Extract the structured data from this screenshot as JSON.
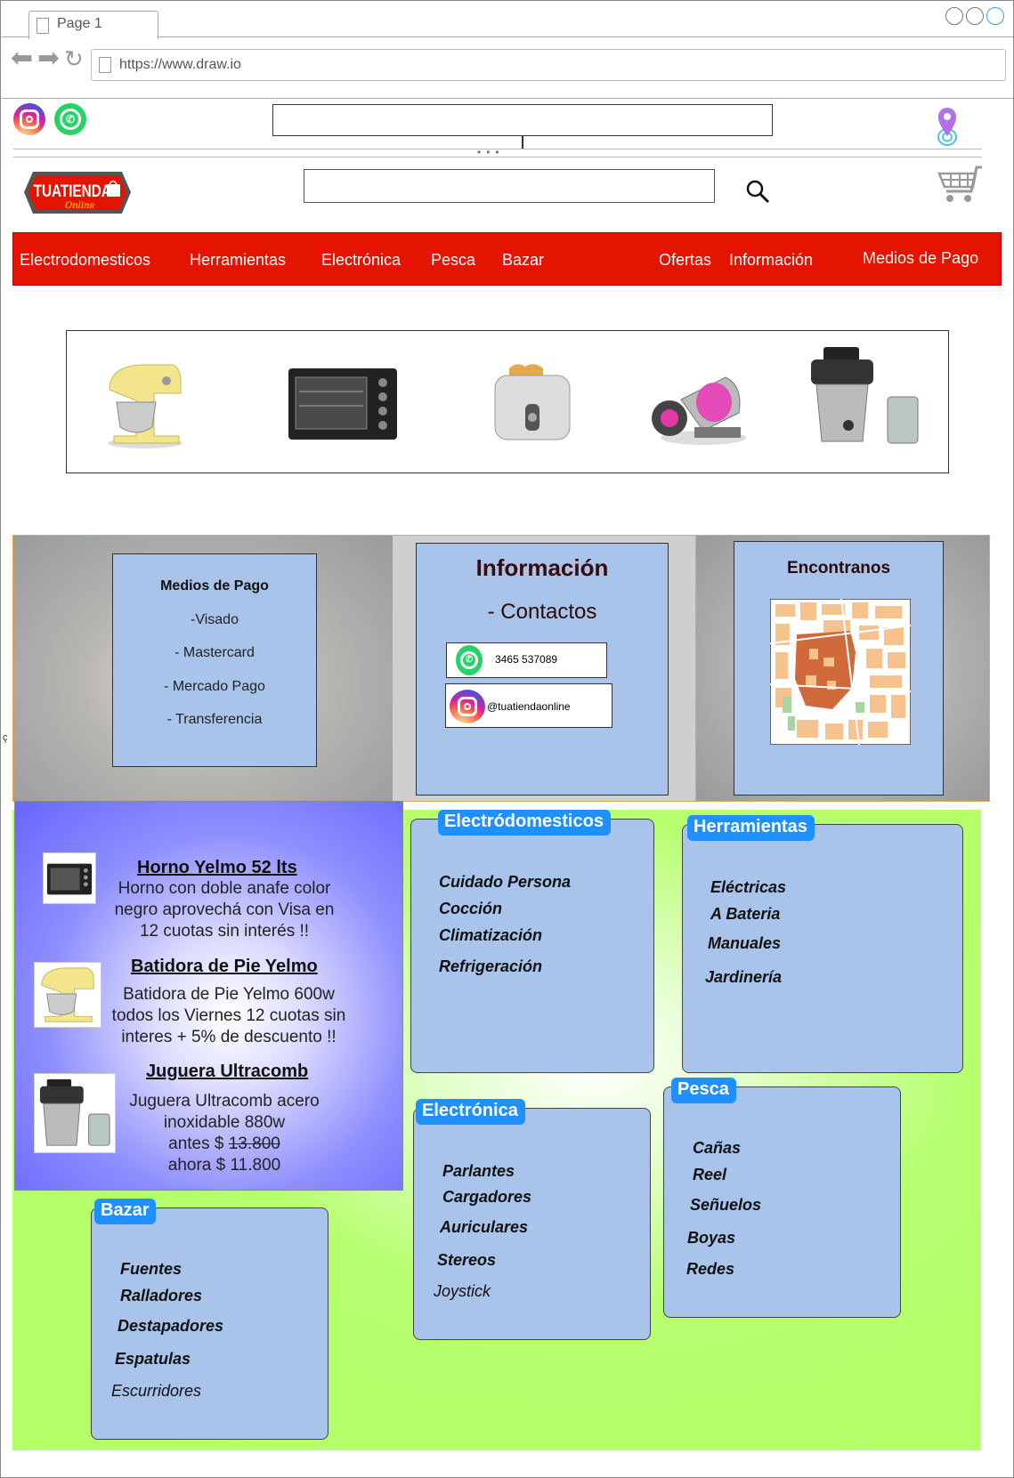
{
  "browser": {
    "tab_title": "Page 1",
    "url": "https://www.draw.io"
  },
  "header": {
    "logo_text": "TUATIENDA",
    "logo_sub": "Online",
    "icons": [
      "instagram-icon",
      "whatsapp-icon",
      "location-pin-icon",
      "search-icon",
      "cart-icon"
    ]
  },
  "menu": {
    "items": [
      "Electrodomesticos",
      "Herramientas",
      "Electrónica",
      "Pesca",
      "Bazar",
      "Ofertas",
      "Información",
      "Medios de Pago"
    ]
  },
  "banner": {
    "products": [
      "stand-mixer",
      "toaster-oven",
      "toaster",
      "vacuum-cleaner",
      "juicer"
    ]
  },
  "payment": {
    "title": "Medios de Pago",
    "items": [
      "-Visado",
      "- Mastercard",
      "- Mercado Pago",
      "- Transferencia"
    ]
  },
  "info": {
    "title": "Información",
    "subtitle": "- Contactos",
    "phone": "3465 537089",
    "instagram": "@tuatiendaonline"
  },
  "find_us": {
    "title": "Encontranos"
  },
  "stray_char": "ç",
  "promos": [
    {
      "title": "Horno Yelmo 52 lts",
      "body": [
        "Horno con doble anafe color",
        "negro aprovechá con Visa en",
        "12 cuotas sin interés !!"
      ]
    },
    {
      "title": "Batidora de Pie Yelmo",
      "body": [
        "Batidora de Pie Yelmo 600w",
        "todos los Viernes 12 cuotas sin",
        "interes + 5% de descuento !!"
      ]
    },
    {
      "title": "Juguera Ultracomb",
      "body": [
        "Juguera Ultracomb acero",
        "inoxidable 880w"
      ],
      "before_label": "antes $ ",
      "before_price": "13.800",
      "now": "ahora $ 11.800"
    }
  ],
  "categories": {
    "electro": {
      "label": "Electródomesticos",
      "items": [
        "Cuidado Persona",
        "Cocción",
        "Climatización",
        "Refrigeración"
      ]
    },
    "herramientas": {
      "label": "Herramientas",
      "items": [
        "Eléctricas",
        "A Bateria",
        "Manuales",
        "Jardinería"
      ]
    },
    "electronica": {
      "label": "Electrónica",
      "items": [
        "Parlantes",
        "Cargadores",
        "Auriculares",
        "Stereos",
        "Joystick"
      ]
    },
    "pesca": {
      "label": "Pesca",
      "items": [
        "Cañas",
        "Reel",
        "Señuelos",
        "Boyas",
        "Redes"
      ]
    },
    "bazar": {
      "label": "Bazar",
      "items": [
        "Fuentes",
        "Ralladores",
        "Destapadores",
        "Espatulas",
        "Escurridores"
      ]
    }
  },
  "colors": {
    "menu_red": "#e51400",
    "card_blue": "#a9c4eb",
    "label_blue": "#1e90ff",
    "promo_purple": "#6666ff",
    "green_bg": "#b4ff66"
  }
}
